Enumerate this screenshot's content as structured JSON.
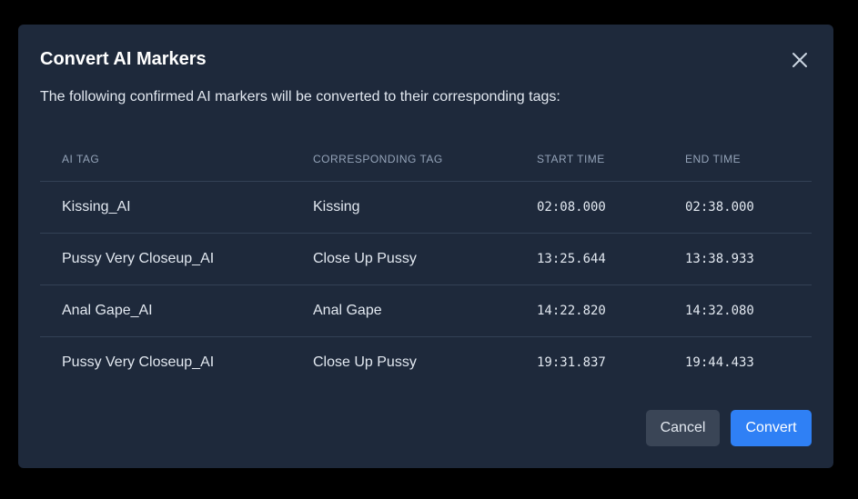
{
  "dialog": {
    "title": "Convert AI Markers",
    "description": "The following confirmed AI markers will be converted to their corresponding tags:",
    "columns": {
      "ai_tag": "AI TAG",
      "corresponding_tag": "CORRESPONDING TAG",
      "start_time": "START TIME",
      "end_time": "END TIME"
    },
    "rows": [
      {
        "ai_tag": "Kissing_AI",
        "corresponding_tag": "Kissing",
        "start_time": "02:08.000",
        "end_time": "02:38.000"
      },
      {
        "ai_tag": "Pussy Very Closeup_AI",
        "corresponding_tag": "Close Up Pussy",
        "start_time": "13:25.644",
        "end_time": "13:38.933"
      },
      {
        "ai_tag": "Anal Gape_AI",
        "corresponding_tag": "Anal Gape",
        "start_time": "14:22.820",
        "end_time": "14:32.080"
      },
      {
        "ai_tag": "Pussy Very Closeup_AI",
        "corresponding_tag": "Close Up Pussy",
        "start_time": "19:31.837",
        "end_time": "19:44.433"
      }
    ],
    "buttons": {
      "cancel": "Cancel",
      "convert": "Convert"
    },
    "close_icon": "close-icon"
  },
  "colors": {
    "backdrop": "#000000",
    "modal_bg": "#1e293b",
    "primary": "#2f80f5",
    "secondary_button": "#3a4556",
    "divider": "#334155"
  }
}
